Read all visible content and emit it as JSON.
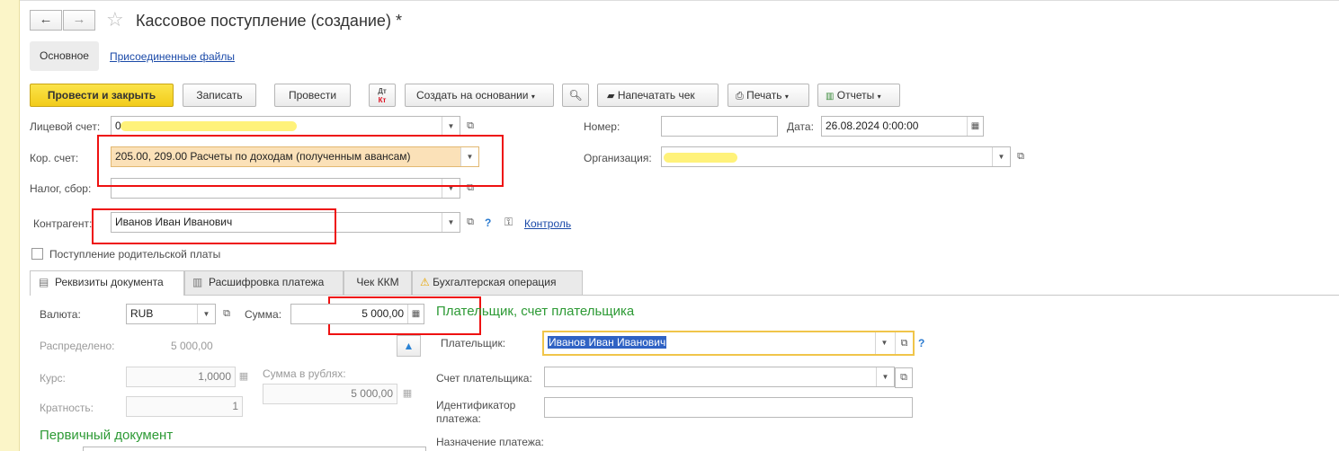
{
  "window": {
    "title": "Кассовое поступление (создание) *"
  },
  "nav": {
    "back_icon": "arrow-left",
    "forward_icon": "arrow-right",
    "favorite_icon": "star"
  },
  "sections": {
    "main": "Основное",
    "files": "Присоединенные файлы"
  },
  "toolbar": {
    "post_close": "Провести и закрыть",
    "save": "Записать",
    "post": "Провести",
    "dtkt_top": "Дт",
    "dtkt_bottom": "Кт",
    "create_based": "Создать на основании",
    "print_receipt": "Напечатать чек",
    "print": "Печать",
    "reports": "Отчеты"
  },
  "header": {
    "account_label": "Лицевой счет:",
    "account_value": "0",
    "corr_account_label": "Кор. счет:",
    "corr_account_value": "205.00, 209.00 Расчеты по доходам (полученным авансам)",
    "tax_label": "Налог, сбор:",
    "tax_value": "",
    "counterparty_label": "Контрагент:",
    "counterparty_value": "Иванов Иван Иванович",
    "control_link": "Контроль",
    "parent_fee_label": "Поступление родительской платы",
    "number_label": "Номер:",
    "number_value": "",
    "date_label": "Дата:",
    "date_value": "26.08.2024  0:00:00",
    "org_label": "Организация:",
    "org_value": ""
  },
  "tabs": [
    {
      "label": "Реквизиты документа"
    },
    {
      "label": "Расшифровка платежа"
    },
    {
      "label": "Чек ККМ"
    },
    {
      "label": "Бухгалтерская операция"
    }
  ],
  "details": {
    "currency_label": "Валюта:",
    "currency_value": "RUB",
    "sum_label": "Сумма:",
    "sum_value": "5 000,00",
    "distributed_label": "Распределено:",
    "distributed_value": "5 000,00",
    "rate_label": "Курс:",
    "rate_value": "1,0000",
    "rub_sum_label": "Сумма в рублях:",
    "rub_sum_value": "5 000,00",
    "multiplicity_label": "Кратность:",
    "multiplicity_value": "1",
    "primary_doc_heading": "Первичный документ"
  },
  "payer": {
    "heading": "Плательщик, счет плательщика",
    "payer_label": "Плательщик:",
    "payer_value": "Иванов Иван Иванович",
    "payer_account_label": "Счет плательщика:",
    "payer_account_value": "",
    "payment_id_label": "Идентификатор платежа:",
    "payment_id_value": "",
    "purpose_label": "Назначение платежа:"
  },
  "colors": {
    "accent_yellow": "#f5d327",
    "highlight_red": "#e11111",
    "section_green": "#2d9a35",
    "link_blue": "#1b4aa8"
  }
}
